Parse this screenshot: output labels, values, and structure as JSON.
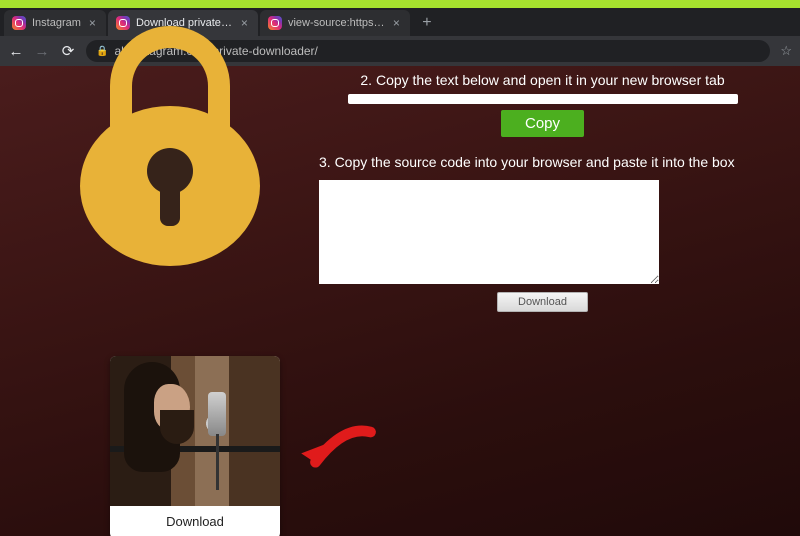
{
  "tabs": {
    "t0": {
      "title": "Instagram"
    },
    "t1": {
      "title": "Download private instagram vid"
    },
    "t2": {
      "title": "view-source:https://www.instagr"
    }
  },
  "omnibox": {
    "url": "aloinstagram.com/private-downloader/"
  },
  "step2": {
    "label": "2. Copy the text below and open it in your new browser tab",
    "copy_label": "Copy"
  },
  "step3": {
    "label": "3. Copy the source code into your browser and paste it into the box",
    "textarea_value": "",
    "download_label": "Download"
  },
  "result": {
    "download_label": "Download"
  }
}
